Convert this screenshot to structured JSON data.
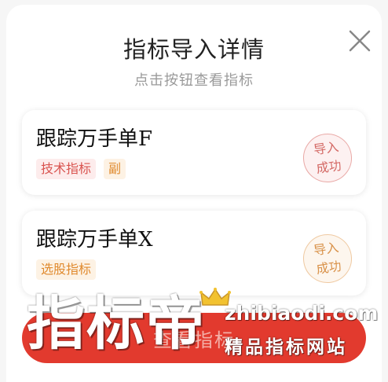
{
  "dialog": {
    "title": "指标导入详情",
    "subtitle": "点击按钮查看指标",
    "close_icon": "close-icon"
  },
  "items": [
    {
      "name": "跟踪万手单F",
      "tags": [
        "技术指标",
        "副"
      ],
      "stamp": [
        "导入",
        "成功"
      ],
      "stamp_color": "#d46a66"
    },
    {
      "name": "跟踪万手单X",
      "tags": [
        "选股指标"
      ],
      "stamp": [
        "导入",
        "成功"
      ],
      "stamp_color": "#d9924a"
    }
  ],
  "bottom_button": {
    "label": "查看指标",
    "color": "#e23a2e"
  },
  "watermark": {
    "brand": "指标帝",
    "url": "zhibiaodi.com",
    "slogan": "精品指标网站",
    "icon": "crown-icon"
  }
}
